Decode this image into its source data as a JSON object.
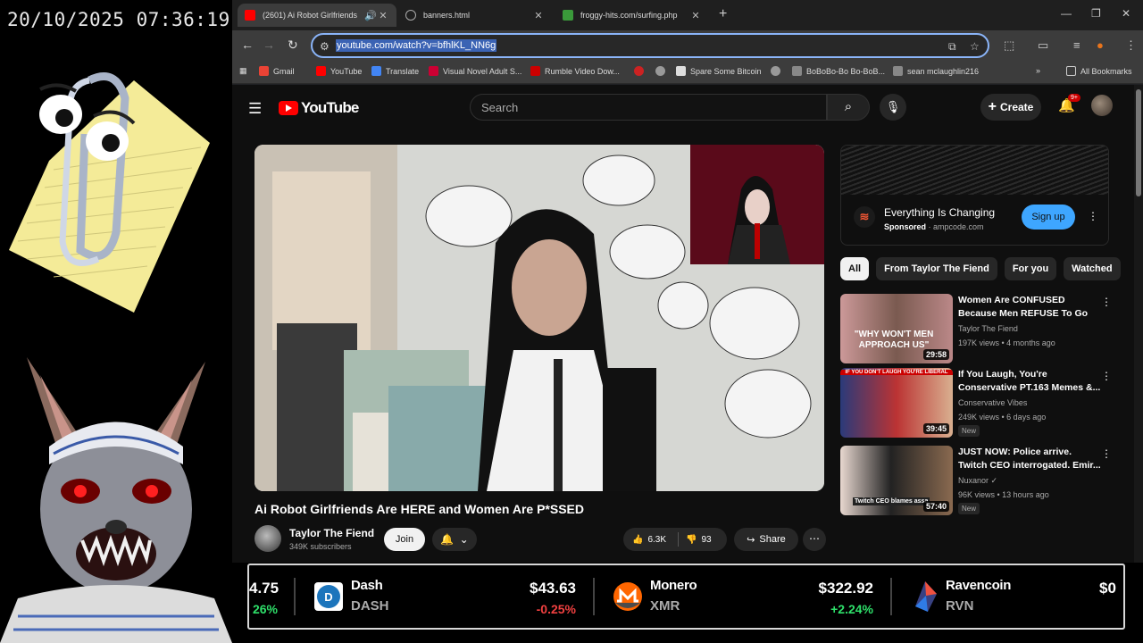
{
  "clock": "20/10/2025 07:36:19",
  "tabs": [
    {
      "title": "(2601) Ai Robot Girlfriends",
      "active": true
    },
    {
      "title": "banners.html",
      "active": false
    },
    {
      "title": "froggy-hits.com/surfing.php",
      "active": false
    }
  ],
  "address_url": "youtube.com/watch?v=bfhlKL_NN6g",
  "bookmarks": [
    "Gmail",
    "YouTube",
    "Translate",
    "Visual Novel Adult S...",
    "Rumble Video Dow...",
    "Spare Some Bitcoin",
    "BoBoBo-Bo Bo-BoB...",
    "sean mclaughlin216",
    "All Bookmarks"
  ],
  "yt": {
    "logo": "YouTube",
    "search_placeholder": "Search",
    "create": "Create",
    "notif_badge": "9+",
    "video_title": "Ai Robot Girlfriends Are HERE and Women Are P*SSED",
    "channel": "Taylor The Fiend",
    "subs": "349K subscribers",
    "join": "Join",
    "likes": "6.3K",
    "dislikes": "93",
    "share": "Share",
    "ad": {
      "title": "Everything Is Changing",
      "sponsored": "Sponsored",
      "domain": "· ampcode.com",
      "cta": "Sign up"
    },
    "chips": [
      "All",
      "From Taylor The Fiend",
      "For you",
      "Watched"
    ],
    "recommendations": [
      {
        "title": "Women Are CONFUSED Because Men REFUSE To Go T...",
        "channel": "Taylor The Fiend",
        "meta": "197K views • 4 months ago",
        "duration": "29:58",
        "new": "",
        "thumb_text": "\"WHY WON'T MEN APPROACH US\""
      },
      {
        "title": "If You Laugh, You're Conservative PT.163 Memes &...",
        "channel": "Conservative Vibes",
        "meta": "249K views • 6 days ago",
        "duration": "39:45",
        "new": "New",
        "thumb_text": "IF YOU DON'T LAUGH YOU'RE LIBERAL"
      },
      {
        "title": "JUST NOW: Police arrive. Twitch CEO interrogated. Emir...",
        "channel": "Nuxanor ✓",
        "meta": "96K views • 13 hours ago",
        "duration": "57:40",
        "new": "New",
        "thumb_text": "Twitch CEO blames assa"
      }
    ]
  },
  "ticker": [
    {
      "name": "",
      "symbol": "",
      "price": "4.75",
      "change": "26%",
      "dir": "up"
    },
    {
      "name": "Dash",
      "symbol": "DASH",
      "price": "$43.63",
      "change": "-0.25%",
      "dir": "down"
    },
    {
      "name": "Monero",
      "symbol": "XMR",
      "price": "$322.92",
      "change": "+2.24%",
      "dir": "up"
    },
    {
      "name": "Ravencoin",
      "symbol": "RVN",
      "price": "$0",
      "change": "",
      "dir": "up"
    }
  ],
  "colors": {
    "yt_red": "#ff0000",
    "accent_blue": "#3ea6ff",
    "up": "#2ee06a",
    "down": "#f04040"
  }
}
